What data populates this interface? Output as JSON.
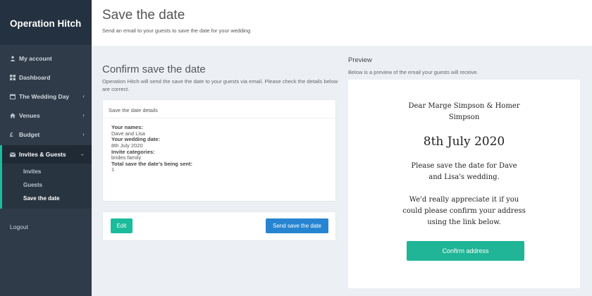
{
  "brand": "Operation Hitch",
  "sidebar": {
    "items": [
      {
        "label": "My account",
        "icon": "user-icon",
        "has_children": false
      },
      {
        "label": "Dashboard",
        "icon": "grid-icon",
        "has_children": false
      },
      {
        "label": "The Wedding Day",
        "icon": "calendar-icon",
        "has_children": true
      },
      {
        "label": "Venues",
        "icon": "home-icon",
        "has_children": true
      },
      {
        "label": "Budget",
        "icon": "pound-icon",
        "has_children": true
      },
      {
        "label": "Invites & Guests",
        "icon": "envelope-icon",
        "has_children": true,
        "expanded": true
      }
    ],
    "subitems": [
      "Invites",
      "Guests",
      "Save the date"
    ],
    "logout": "Logout",
    "accent_color": "#1abc9c"
  },
  "header": {
    "title": "Save the date",
    "subtitle": "Send an email to your guests to save the date for your wedding"
  },
  "confirm": {
    "title": "Confirm save the date",
    "description": "Operation Hitch will send the save the date to your guests via email. Please check the details below are correct.",
    "card_title": "Save the date details",
    "names_label": "Your names:",
    "names_value": "Dave and Lisa",
    "date_label": "Your wedding date:",
    "date_value": "8th July 2020",
    "categories_label": "Invite categories:",
    "categories_value": "brides family",
    "total_label": "Total save the date's being sent:",
    "total_value": "1",
    "edit_label": "Edit",
    "send_label": "Send save the date"
  },
  "preview": {
    "title": "Preview",
    "description": "Below is a preview of the email your guests will receive.",
    "dear": "Dear Marge Simpson & Homer Simpson",
    "date": "8th July 2020",
    "please": "Please save the date for Dave and Lisa's wedding.",
    "appreciate": "We'd really appreciate it if you could please confirm your address using the link below.",
    "confirm_label": "Confirm address"
  }
}
